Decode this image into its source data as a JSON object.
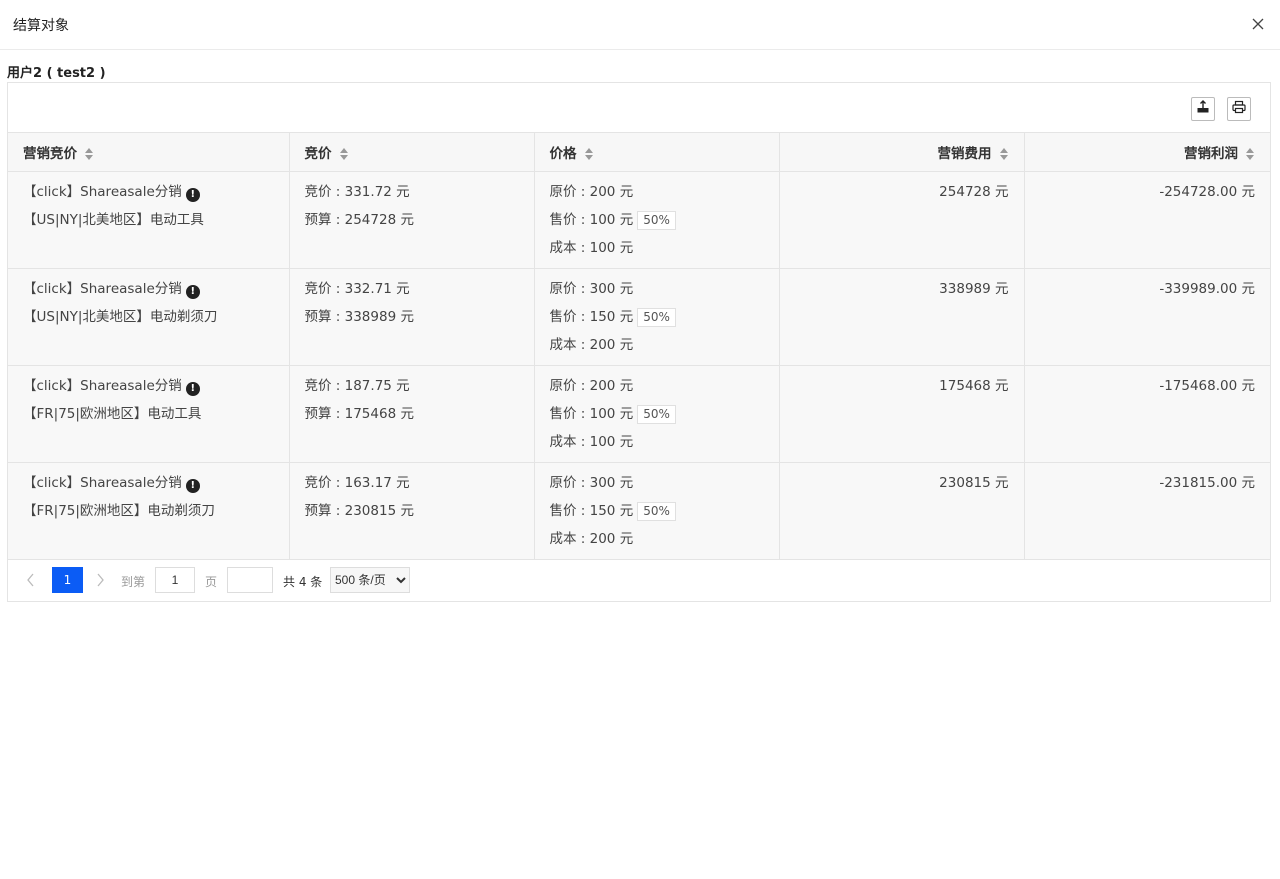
{
  "dialog": {
    "title": "结算对象",
    "close_icon": "close-icon"
  },
  "section": {
    "title": "用户2 ( test2 )"
  },
  "toolbar": {
    "export_icon": "export-icon",
    "print_icon": "print-icon"
  },
  "table": {
    "columns": [
      {
        "label": "营销竞价",
        "align": "left"
      },
      {
        "label": "竞价",
        "align": "left"
      },
      {
        "label": "价格",
        "align": "left"
      },
      {
        "label": "营销费用",
        "align": "right"
      },
      {
        "label": "营销利润",
        "align": "right"
      }
    ],
    "rows": [
      {
        "campaign": "【click】Shareasale分销",
        "info_badge": "!",
        "region": "【US|NY|北美地区】电动工具",
        "bid": "竞价 : 331.72 元",
        "budget": "预算 : 254728 元",
        "original_price": "原价 : 200 元",
        "sale_price": "售价 : 100 元",
        "discount": "50%",
        "cost": "成本 : 100 元",
        "marketing_fee": "254728 元",
        "profit": "-254728.00 元"
      },
      {
        "campaign": "【click】Shareasale分销",
        "info_badge": "!",
        "region": "【US|NY|北美地区】电动剃须刀",
        "bid": "竞价 : 332.71 元",
        "budget": "预算 : 338989 元",
        "original_price": "原价 : 300 元",
        "sale_price": "售价 : 150 元",
        "discount": "50%",
        "cost": "成本 : 200 元",
        "marketing_fee": "338989 元",
        "profit": "-339989.00 元"
      },
      {
        "campaign": "【click】Shareasale分销",
        "info_badge": "!",
        "region": "【FR|75|欧洲地区】电动工具",
        "bid": "竞价 : 187.75 元",
        "budget": "预算 : 175468 元",
        "original_price": "原价 : 200 元",
        "sale_price": "售价 : 100 元",
        "discount": "50%",
        "cost": "成本 : 100 元",
        "marketing_fee": "175468 元",
        "profit": "-175468.00 元"
      },
      {
        "campaign": "【click】Shareasale分销",
        "info_badge": "!",
        "region": "【FR|75|欧洲地区】电动剃须刀",
        "bid": "竞价 : 163.17 元",
        "budget": "预算 : 230815 元",
        "original_price": "原价 : 300 元",
        "sale_price": "售价 : 150 元",
        "discount": "50%",
        "cost": "成本 : 200 元",
        "marketing_fee": "230815 元",
        "profit": "-231815.00 元"
      }
    ]
  },
  "pagination": {
    "prev_icon": "‹",
    "current_page": "1",
    "next_icon": "›",
    "goto_label": "到第",
    "goto_value": "1",
    "page_label": "页",
    "total_label": "共 4 条",
    "page_size": "500 条/页",
    "page_size_options": [
      "500 条/页"
    ]
  },
  "colors": {
    "primary": "#0b5cf5",
    "header_bg": "#f7f7f7",
    "row_bg": "#f8f8f8",
    "border": "#e4e4e4"
  }
}
